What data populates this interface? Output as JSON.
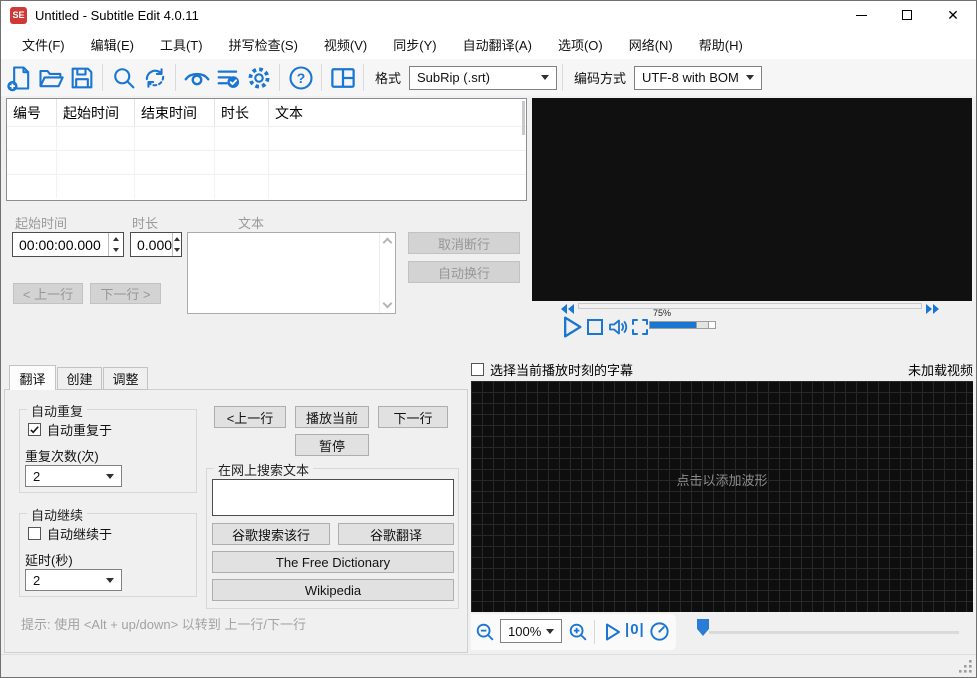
{
  "window": {
    "title": "Untitled - Subtitle Edit 4.0.11",
    "icon_text": "SE"
  },
  "menu": {
    "items": [
      "文件(F)",
      "编辑(E)",
      "工具(T)",
      "拼写检查(S)",
      "视频(V)",
      "同步(Y)",
      "自动翻译(A)",
      "选项(O)",
      "网络(N)",
      "帮助(H)"
    ]
  },
  "toolbar": {
    "icons": [
      "new-file",
      "open-file",
      "save-file",
      "find",
      "replace",
      "visual-sync",
      "spell-check",
      "settings",
      "help",
      "layout"
    ],
    "format_label": "格式",
    "format_value": "SubRip (.srt)",
    "encoding_label": "编码方式",
    "encoding_value": "UTF-8 with BOM"
  },
  "list_view": {
    "columns": [
      "编号",
      "起始时间",
      "结束时间",
      "时长",
      "文本"
    ]
  },
  "edit_panel": {
    "start_label": "起始时间",
    "start_value": "00:00:00.000",
    "duration_label": "时长",
    "duration_value": "0.000",
    "text_label": "文本",
    "unbreak_button": "取消断行",
    "autobreak_button": "自动换行",
    "prev_button": "< 上一行",
    "next_button": "下一行 >"
  },
  "video": {
    "volume": "75%"
  },
  "tabs": {
    "items": [
      "翻译",
      "创建",
      "调整"
    ],
    "active": "翻译"
  },
  "translate": {
    "auto_repeat": {
      "title": "自动重复",
      "checkbox": "自动重复于",
      "checked": true,
      "count_label": "重复次数(次)",
      "count_value": "2"
    },
    "auto_continue": {
      "title": "自动继续",
      "checkbox": "自动继续于",
      "checked": false,
      "delay_label": "延时(秒)",
      "delay_value": "2"
    },
    "buttons": {
      "prev": "<上一行",
      "play_current": "播放当前",
      "next": "下一行",
      "pause": "暂停"
    },
    "web_search": {
      "title": "在网上搜索文本",
      "google_line": "谷歌搜索该行",
      "google_translate": "谷歌翻译",
      "free_dictionary": "The Free Dictionary",
      "wikipedia": "Wikipedia"
    },
    "hint": "提示: 使用 <Alt + up/down> 以转到 上一行/下一行"
  },
  "waveform": {
    "select_label": "选择当前播放时刻的字幕",
    "status": "未加载视频",
    "placeholder": "点击以添加波形",
    "zoom_value": "100%",
    "zero_icon": "|0|"
  },
  "colors": {
    "accent": "#1b76d2",
    "app_icon_red": "#cf3a36",
    "waveform_bg": "#0e0e0e",
    "panel_bg": "#f0f0f0"
  }
}
